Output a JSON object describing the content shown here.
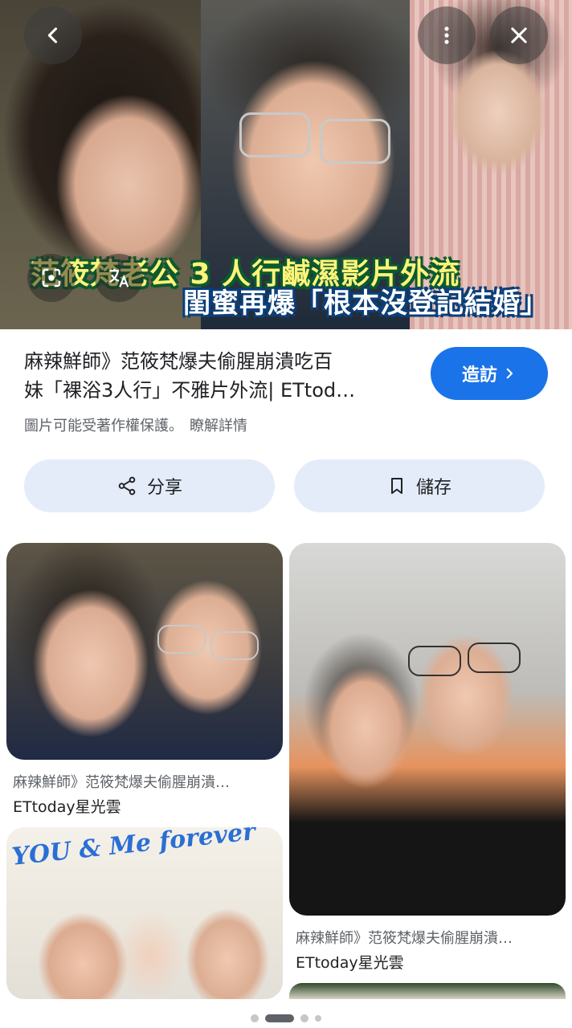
{
  "hero": {
    "caption_line1": "范筱梵老公 3 人行鹹濕影片外流",
    "caption_line2": "閨蜜再爆「根本沒登記結婚」"
  },
  "topbar": {
    "back_icon": "chevron-left-icon",
    "more_icon": "more-vert-icon",
    "close_icon": "close-icon"
  },
  "result": {
    "title_line1": "麻辣鮮師》范筱梵爆夫偷腥崩潰吃百",
    "title_line2": "妹「裸浴3人行」不雅片外流| ETtod…",
    "visit_label": "造訪",
    "copyright_text": "圖片可能受著作權保護。",
    "learn_more": "瞭解詳情"
  },
  "actions": {
    "share_label": "分享",
    "save_label": "儲存"
  },
  "related": [
    {
      "title": "麻辣鮮師》范筱梵爆夫偷腥崩潰…",
      "source": "ETtoday星光雲"
    },
    {
      "title": "麻辣鮮師》范筱梵爆夫偷腥崩潰…",
      "source": "ETtoday星光雲"
    }
  ],
  "thumb_text": {
    "forever": "YOU & Me forever"
  },
  "colors": {
    "accent": "#1a73e8",
    "chip_bg": "#e4ecfa"
  }
}
